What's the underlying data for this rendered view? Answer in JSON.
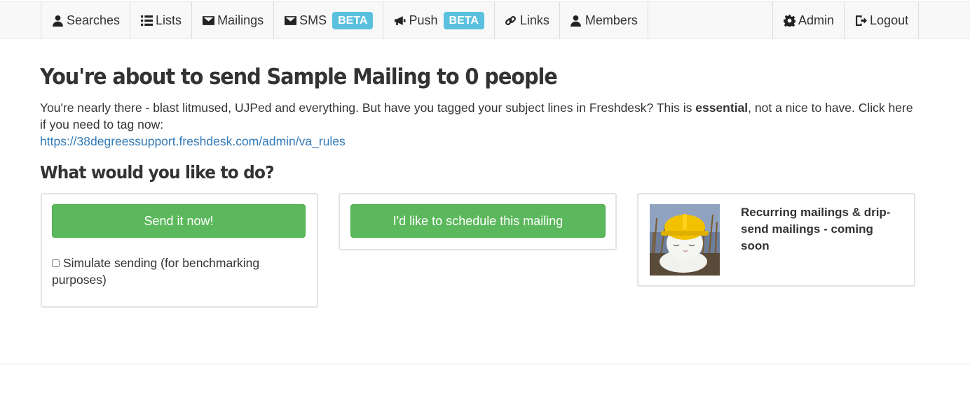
{
  "nav": {
    "left": [
      {
        "label": "Searches",
        "icon": "user-icon"
      },
      {
        "label": "Lists",
        "icon": "list-icon"
      },
      {
        "label": "Mailings",
        "icon": "envelope-icon"
      },
      {
        "label": "SMS",
        "icon": "envelope-icon",
        "badge": "BETA"
      },
      {
        "label": "Push",
        "icon": "bullhorn-icon",
        "badge": "BETA"
      },
      {
        "label": "Links",
        "icon": "link-icon"
      },
      {
        "label": "Members",
        "icon": "user-icon"
      }
    ],
    "right": [
      {
        "label": "Admin",
        "icon": "gear-icon"
      },
      {
        "label": "Logout",
        "icon": "logout-icon"
      }
    ]
  },
  "main": {
    "title": "You're about to send Sample Mailing to 0 people",
    "intro_before": "You're nearly there - blast litmused, UJPed and everything. But have you tagged your subject lines in Freshdesk? This is ",
    "intro_bold": "essential",
    "intro_after": ", not a nice to have. Click here if you need to tag now:",
    "intro_link": "https://38degreessupport.freshdesk.com/admin/va_rules",
    "subtitle": "What would you like to do?"
  },
  "options": {
    "send_now_label": "Send it now!",
    "simulate_label": "Simulate sending (for benchmarking purposes)",
    "simulate_checked": false,
    "schedule_label": "I'd like to schedule this mailing",
    "coming_soon_text": "Recurring mailings & drip-send mailings - coming soon"
  },
  "colors": {
    "accent_green": "#5cb85c",
    "beta_badge": "#5bc0de",
    "link": "#337ab7"
  }
}
